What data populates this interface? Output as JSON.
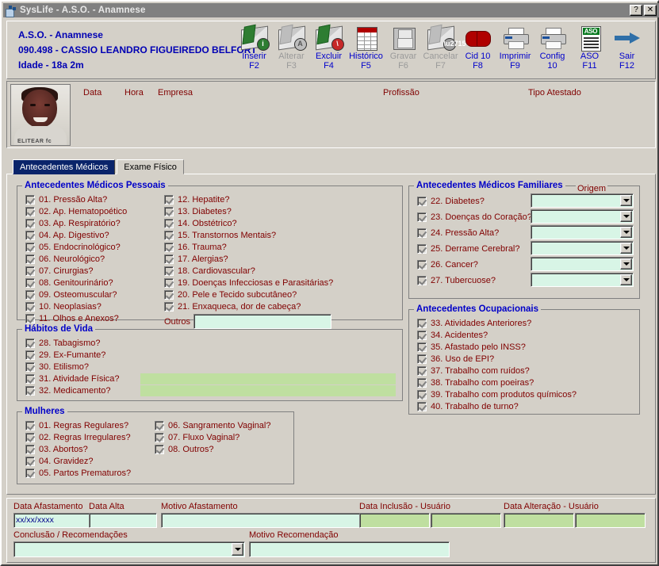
{
  "window": {
    "title": "SysLife - A.S.O. - Anamnese",
    "help_button": "?",
    "close_button": "✕"
  },
  "header": {
    "line1": "A.S.O. - Anamnese",
    "line2": "090.498 - CASSIO LEANDRO FIGUEIREDO BELFORT",
    "line3": "Idade - 18a 2m",
    "toolbar": [
      {
        "label": "Inserir",
        "key": "F2",
        "icon": "envelope-insert-icon",
        "disabled": false
      },
      {
        "label": "Alterar",
        "key": "F3",
        "icon": "envelope-edit-icon",
        "disabled": true
      },
      {
        "label": "Excluir",
        "key": "F4",
        "icon": "envelope-delete-icon",
        "disabled": false
      },
      {
        "label": "Histórico",
        "key": "F5",
        "icon": "grid-history-icon",
        "disabled": false
      },
      {
        "label": "Gravar",
        "key": "F6",
        "icon": "floppy-save-icon",
        "disabled": true
      },
      {
        "label": "Cancelar",
        "key": "F7",
        "icon": "envelope-cancel-icon",
        "disabled": true
      },
      {
        "label": "Cid 10",
        "key": "F8",
        "icon": "book-icon",
        "disabled": false
      },
      {
        "label": "Imprimir",
        "key": "F9",
        "icon": "printer-icon",
        "disabled": false
      },
      {
        "label": "Config",
        "key": "10",
        "icon": "printer-config-icon",
        "disabled": false
      },
      {
        "label": "ASO",
        "key": "F11",
        "icon": "aso-document-icon",
        "disabled": false
      },
      {
        "label": "Sair",
        "key": "F12",
        "icon": "exit-arrow-icon",
        "disabled": false
      }
    ]
  },
  "patient": {
    "columns": [
      "Data",
      "Hora",
      "Empresa",
      "Profissão",
      "Tipo Atestado"
    ],
    "photo_caption": "ELITEAR fc"
  },
  "tabs": [
    {
      "label": "Antecedentes Médicos",
      "active": true
    },
    {
      "label": "Exame Físico",
      "active": false
    }
  ],
  "groups": {
    "pessoais": {
      "caption": "Antecedentes Médicos Pessoais",
      "col1": [
        "01. Pressão Alta?",
        "02. Ap. Hematopoético",
        "03. Ap. Respiratório?",
        "04. Ap. Digestivo?",
        "05. Endocrinológico?",
        "06. Neurológico?",
        "07. Cirurgias?",
        "08. Genitourinário?",
        "09. Osteomuscular?",
        "10. Neoplasias?",
        "11. Olhos e Anexos?"
      ],
      "col2": [
        "12. Hepatite?",
        "13. Diabetes?",
        "14. Obstétrico?",
        "15. Transtornos Mentais?",
        "16. Trauma?",
        "17. Alergias?",
        "18. Cardiovascular?",
        "19. Doenças Infecciosas e Parasitárias?",
        "20. Pele e Tecido subcutâneo?",
        "21. Enxaqueca, dor de cabeça?"
      ],
      "outros_label": "Outros",
      "outros_value": ""
    },
    "habitos": {
      "caption": "Hábitos de Vida",
      "items": [
        {
          "label": "28. Tabagismo?",
          "field": false
        },
        {
          "label": "29. Ex-Fumante?",
          "field": false
        },
        {
          "label": "30. Etilismo?",
          "field": false
        },
        {
          "label": "31. Atividade Física?",
          "field": true,
          "value": ""
        },
        {
          "label": "32. Medicamento?",
          "field": true,
          "value": ""
        }
      ]
    },
    "mulheres": {
      "caption": "Mulheres",
      "col1": [
        "01. Regras Regulares?",
        "02. Regras Irregulares?",
        "03. Abortos?",
        "04. Gravidez?",
        "05. Partos Prematuros?"
      ],
      "col2": [
        "06. Sangramento Vaginal?",
        "07. Fluxo Vaginal?",
        "08. Outros?"
      ]
    },
    "familiares": {
      "caption": "Antecedentes Médicos Familiares",
      "origem_label": "Origem",
      "items": [
        {
          "label": "22. Diabetes?",
          "origem": ""
        },
        {
          "label": "23. Doenças do Coração?",
          "origem": ""
        },
        {
          "label": "24. Pressão Alta?",
          "origem": ""
        },
        {
          "label": "25. Derrame Cerebral?",
          "origem": ""
        },
        {
          "label": "26. Cancer?",
          "origem": ""
        },
        {
          "label": "27. Tubercuose?",
          "origem": ""
        }
      ]
    },
    "ocupacionais": {
      "caption": "Antecedentes Ocupacionais",
      "items": [
        "33. Atividades Anteriores?",
        "34. Acidentes?",
        "35. Afastado pelo INSS?",
        "36. Uso de EPI?",
        "37. Trabalho com ruídos?",
        "38. Trabalho com poeiras?",
        "39. Trabalho com produtos químicos?",
        "40. Trabalho de turno?"
      ]
    }
  },
  "footer": {
    "data_afastamento_label": "Data Afastamento",
    "data_afastamento_value": "xx/xx/xxxx",
    "data_alta_label": "Data Alta",
    "data_alta_value": "",
    "motivo_afastamento_label": "Motivo Afastamento",
    "motivo_afastamento_value": "",
    "data_inclusao_label": "Data Inclusão - Usuário",
    "data_inclusao_value": "",
    "usuario_inclusao_value": "",
    "data_alteracao_label": "Data Alteração - Usuário",
    "data_alteracao_value": "",
    "usuario_alteracao_value": "",
    "conclusao_label": "Conclusão / Recomendações",
    "conclusao_value": "",
    "motivo_recomendacao_label": "Motivo Recomendação",
    "motivo_recomendacao_value": ""
  },
  "colors": {
    "caption_blue": "#0000c8",
    "label_maroon": "#800000",
    "field_mint": "#d8f5e6",
    "field_green": "#bfdfa0",
    "titlebar_gray": "#808080",
    "face_bg": "#d4d0c8"
  }
}
